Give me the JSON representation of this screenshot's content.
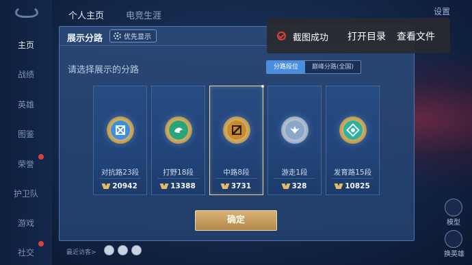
{
  "top_nav": {
    "items": [
      "个人主页",
      "电竞生涯"
    ],
    "settings_label": "设置"
  },
  "sidebar": {
    "items": [
      {
        "label": "主页",
        "active": true
      },
      {
        "label": "战绩"
      },
      {
        "label": "英雄"
      },
      {
        "label": "图鉴"
      },
      {
        "label": "荣誉"
      },
      {
        "label": "护卫队"
      },
      {
        "label": "游戏"
      },
      {
        "label": "社交"
      }
    ]
  },
  "panel": {
    "title": "展示分路",
    "pref_button": "优先显示",
    "subtitle": "请选择展示的分路",
    "segment": {
      "active": "分路段位",
      "inactive": "巅峰分路(全国)"
    },
    "cards": [
      {
        "label": "对抗路23段",
        "points": "20942",
        "icon": "sword-shield-icon",
        "color": "#3a8fe0"
      },
      {
        "label": "打野18段",
        "points": "13388",
        "icon": "dragon-icon",
        "color": "#2aa57a"
      },
      {
        "label": "中路8段",
        "points": "3731",
        "icon": "slash-square-icon",
        "color": "#c98b2a",
        "selected": true
      },
      {
        "label": "游走1段",
        "points": "328",
        "icon": "wings-icon",
        "color": "#8aa8c8"
      },
      {
        "label": "发育路15段",
        "points": "10825",
        "icon": "target-icon",
        "color": "#2ab3a0"
      }
    ],
    "confirm_label": "确定"
  },
  "toast": {
    "message": "截图成功",
    "open_dir": "打开目录",
    "view_file": "查看文件"
  },
  "bottom": {
    "recent_label": "最近访客>"
  },
  "right_buttons": {
    "label_a": "模型",
    "label_b": "换英雄"
  }
}
